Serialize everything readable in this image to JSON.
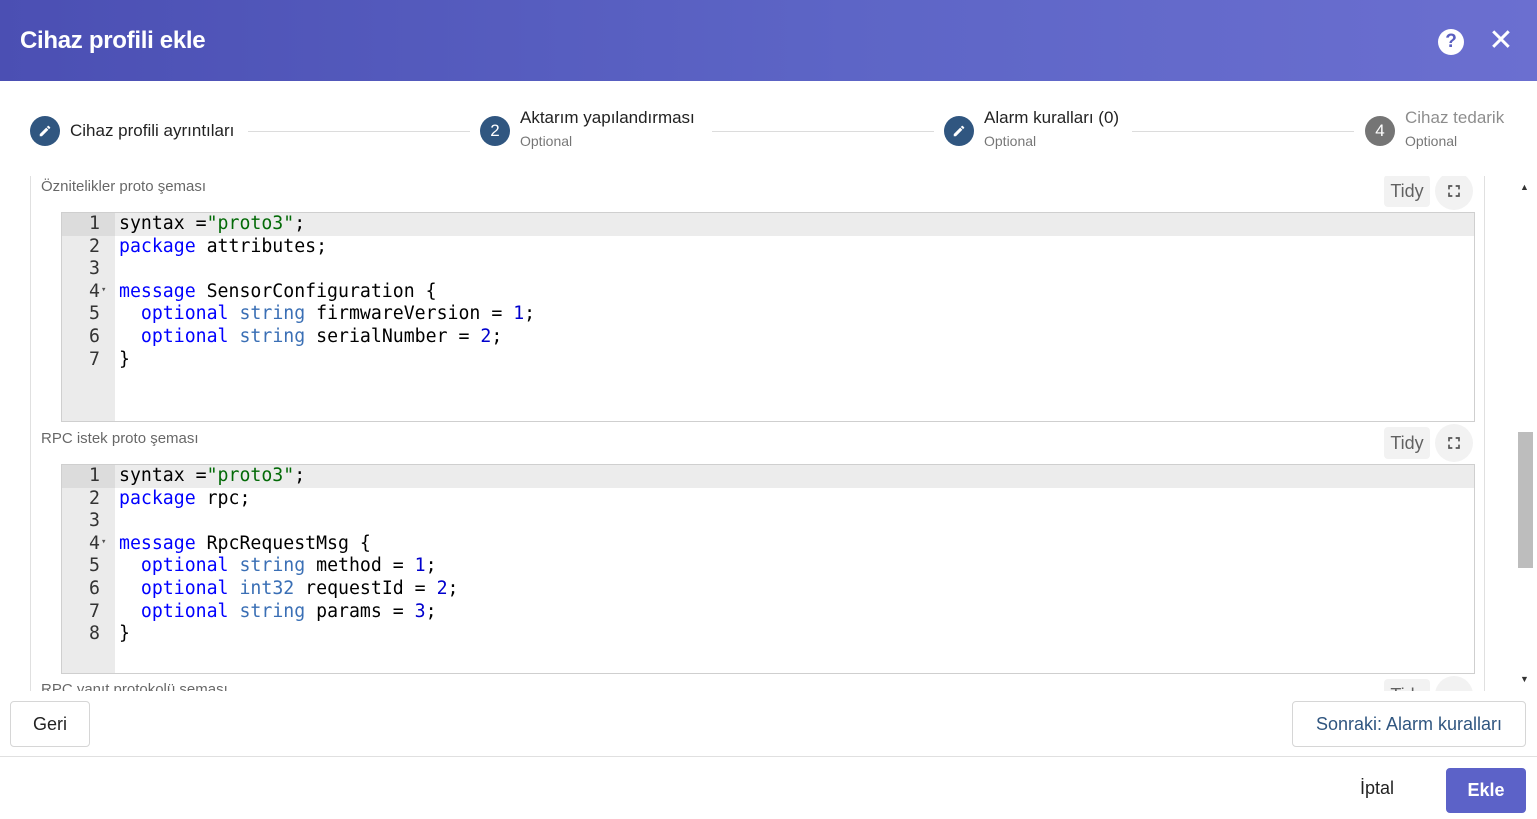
{
  "dialog": {
    "title": "Cihaz profili ekle"
  },
  "icons": {
    "help": "help-circle-icon",
    "close": "close-icon",
    "edit": "pencil-icon",
    "fullscreen": "fullscreen-icon"
  },
  "colors": {
    "header": "#5a5fc0",
    "step_done": "#305680",
    "step_inactive": "#757575",
    "primary_button": "#5c62c8",
    "keyword": "#0000ff",
    "string": "#036a07"
  },
  "stepper": {
    "steps": [
      {
        "label": "Cihaz profili ayrıntıları",
        "state": "edit"
      },
      {
        "number": "2",
        "label": "Aktarım yapılandırması",
        "sub": "Optional",
        "state": "active"
      },
      {
        "label": "Alarm kuralları (0)",
        "sub": "Optional",
        "state": "edit"
      },
      {
        "number": "4",
        "label": "Cihaz tedarik",
        "sub": "Optional",
        "state": "inactive"
      }
    ]
  },
  "editors": [
    {
      "label": "Öznitelikler proto şeması",
      "tidy": "Tidy",
      "lines": [
        [
          [
            "syntax =",
            ""
          ],
          [
            "\"proto3\"",
            "str"
          ],
          [
            ";",
            ""
          ]
        ],
        [
          [
            "package",
            "kw"
          ],
          [
            " attributes;",
            ""
          ]
        ],
        [],
        [
          [
            "message",
            "kw"
          ],
          [
            " SensorConfiguration {",
            ""
          ]
        ],
        [
          [
            "  ",
            ""
          ],
          [
            "optional",
            "kw"
          ],
          [
            " ",
            ""
          ],
          [
            "string",
            "ty"
          ],
          [
            " firmwareVersion = ",
            ""
          ],
          [
            "1",
            "num"
          ],
          [
            ";",
            ""
          ]
        ],
        [
          [
            "  ",
            ""
          ],
          [
            "optional",
            "kw"
          ],
          [
            " ",
            ""
          ],
          [
            "string",
            "ty"
          ],
          [
            " serialNumber = ",
            ""
          ],
          [
            "2",
            "num"
          ],
          [
            ";",
            ""
          ]
        ],
        [
          [
            "}",
            ""
          ]
        ]
      ],
      "folds": [
        4
      ]
    },
    {
      "label": "RPC istek proto şeması",
      "tidy": "Tidy",
      "lines": [
        [
          [
            "syntax =",
            ""
          ],
          [
            "\"proto3\"",
            "str"
          ],
          [
            ";",
            ""
          ]
        ],
        [
          [
            "package",
            "kw"
          ],
          [
            " rpc;",
            ""
          ]
        ],
        [],
        [
          [
            "message",
            "kw"
          ],
          [
            " RpcRequestMsg {",
            ""
          ]
        ],
        [
          [
            "  ",
            ""
          ],
          [
            "optional",
            "kw"
          ],
          [
            " ",
            ""
          ],
          [
            "string",
            "ty"
          ],
          [
            " method = ",
            ""
          ],
          [
            "1",
            "num"
          ],
          [
            ";",
            ""
          ]
        ],
        [
          [
            "  ",
            ""
          ],
          [
            "optional",
            "kw"
          ],
          [
            " ",
            ""
          ],
          [
            "int32",
            "ty"
          ],
          [
            " requestId = ",
            ""
          ],
          [
            "2",
            "num"
          ],
          [
            ";",
            ""
          ]
        ],
        [
          [
            "  ",
            ""
          ],
          [
            "optional",
            "kw"
          ],
          [
            " ",
            ""
          ],
          [
            "string",
            "ty"
          ],
          [
            " params = ",
            ""
          ],
          [
            "3",
            "num"
          ],
          [
            ";",
            ""
          ]
        ],
        [
          [
            "}",
            ""
          ]
        ]
      ],
      "folds": [
        4
      ]
    }
  ],
  "partial_label": "RPC yanıt protokolü şeması",
  "partial_tidy": "Tidy",
  "nav": {
    "back": "Geri",
    "next": "Sonraki: Alarm kuralları"
  },
  "footer": {
    "cancel": "İptal",
    "add": "Ekle"
  }
}
